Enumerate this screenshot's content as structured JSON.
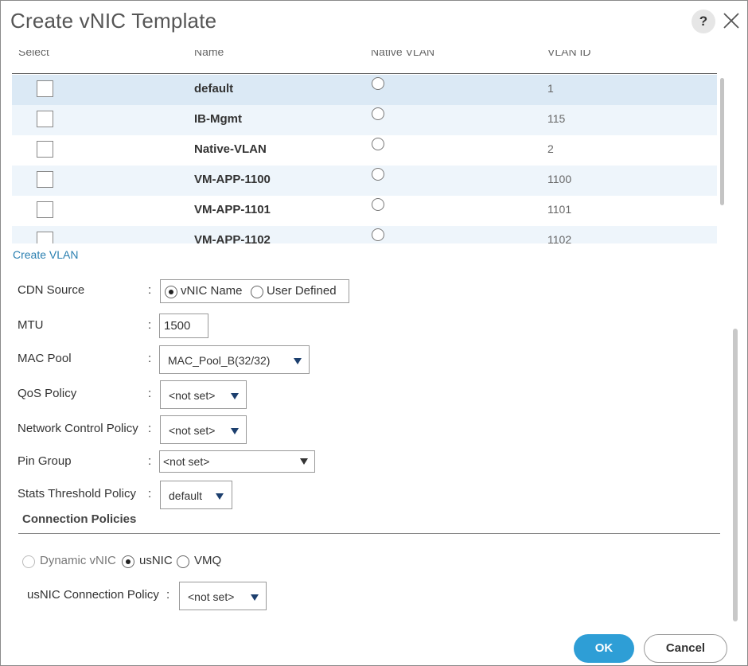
{
  "dialog": {
    "title": "Create vNIC Template",
    "help": "?"
  },
  "table": {
    "headers": [
      "Select",
      "Name",
      "Native VLAN",
      "VLAN ID"
    ],
    "rows": [
      {
        "name": "default",
        "vlan_id": "1"
      },
      {
        "name": "IB-Mgmt",
        "vlan_id": "115"
      },
      {
        "name": "Native-VLAN",
        "vlan_id": "2"
      },
      {
        "name": "VM-APP-1100",
        "vlan_id": "1100"
      },
      {
        "name": "VM-APP-1101",
        "vlan_id": "1101"
      },
      {
        "name": "VM-APP-1102",
        "vlan_id": "1102"
      }
    ]
  },
  "create_vlan_link": "Create VLAN",
  "form": {
    "colon": ":",
    "cdn_source": {
      "label": "CDN Source",
      "options": [
        "vNIC Name",
        "User Defined"
      ],
      "selected": "vNIC Name"
    },
    "mtu": {
      "label": "MTU",
      "value": "1500"
    },
    "mac_pool": {
      "label": "MAC Pool",
      "value": "MAC_Pool_B(32/32)"
    },
    "qos_policy": {
      "label": "QoS Policy",
      "value": "<not set>"
    },
    "network_control_policy": {
      "label": "Network Control Policy",
      "value": "<not set>"
    },
    "pin_group": {
      "label": "Pin Group",
      "value": "<not set>"
    },
    "stats_threshold_policy": {
      "label": "Stats Threshold Policy",
      "value": "default"
    }
  },
  "connection_policies": {
    "title": "Connection Policies",
    "options": [
      "Dynamic vNIC",
      "usNIC",
      "VMQ"
    ],
    "selected": "usNIC",
    "usnic_policy": {
      "label": "usNIC Connection Policy",
      "value": "<not set>"
    }
  },
  "buttons": {
    "ok": "OK",
    "cancel": "Cancel"
  },
  "colors": {
    "accent": "#2e9ed6",
    "link": "#2a7fb0",
    "row_alt": "#eef5fb",
    "row_selected": "#dbe9f5"
  }
}
